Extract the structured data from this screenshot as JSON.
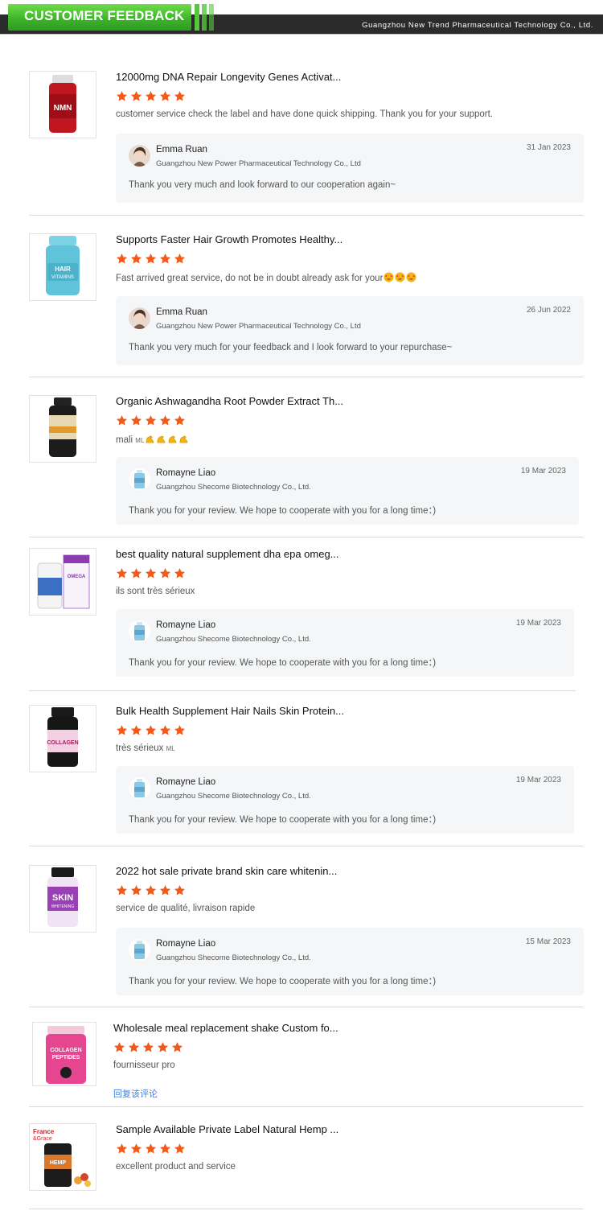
{
  "header": {
    "title": "CUSTOMER FEEDBACK",
    "company": "Guangzhou New Trend Pharmaceutical Technology Co., Ltd.",
    "accent_color": "#3cb62a",
    "bar_color": "#2b2b2b"
  },
  "star_color": "#f05a1a",
  "reviews": [
    {
      "title": "12000mg DNA Repair Longevity Genes Activat...",
      "rating": 5,
      "text": "customer service check the label and have done quick shipping. Thank you for your support.",
      "image_icon": "nmn-bottle",
      "reply": {
        "name": "Emma Ruan",
        "company": "Guangzhou New Power Pharmaceutical Technology Co., Ltd",
        "date": "31 Jan 2023",
        "text": "Thank you very much and look forward to our cooperation again~",
        "avatar": "woman-avatar"
      }
    },
    {
      "title": "Supports Faster Hair Growth Promotes Healthy...",
      "rating": 5,
      "text": "Fast arrived great service, do not be in doubt already ask for your",
      "emojis": [
        "star-struck-emoji",
        "star-struck-emoji",
        "star-struck-emoji"
      ],
      "image_icon": "hair-vitamins-jar",
      "reply": {
        "name": "Emma Ruan",
        "company": "Guangzhou New Power Pharmaceutical Technology Co., Ltd",
        "date": "26 Jun 2022",
        "text": "Thank you very much for your feedback and I look forward to your repurchase~",
        "avatar": "woman-avatar"
      }
    },
    {
      "title": "Organic Ashwagandha Root Powder Extract Th...",
      "rating": 5,
      "text": "mali",
      "suffix": "ML",
      "emojis": [
        "flexed-biceps-emoji",
        "flexed-biceps-emoji",
        "flexed-biceps-emoji",
        "flexed-biceps-emoji"
      ],
      "image_icon": "ashwagandha-bottle",
      "reply": {
        "name": "Romayne Liao",
        "company": "Guangzhou Shecome Biotechnology Co., Ltd.",
        "date": "19 Mar 2023",
        "text": "Thank you for your review. We hope to cooperate with you for a long time：)",
        "avatar": "bottle-avatar"
      }
    },
    {
      "title": "best quality natural supplement dha epa omeg...",
      "rating": 5,
      "text": "ils sont très sérieux",
      "image_icon": "omega-bottle",
      "reply": {
        "name": "Romayne Liao",
        "company": "Guangzhou Shecome Biotechnology Co., Ltd.",
        "date": "19 Mar 2023",
        "text": "Thank you for your review. We hope to cooperate with you for a long time：)",
        "avatar": "bottle-avatar"
      }
    },
    {
      "title": "Bulk Health Supplement Hair Nails Skin Protein...",
      "rating": 5,
      "text": "très sérieux",
      "suffix": "ML",
      "image_icon": "collagen-bottle",
      "reply": {
        "name": "Romayne Liao",
        "company": "Guangzhou Shecome Biotechnology Co., Ltd.",
        "date": "19 Mar 2023",
        "text": "Thank you for your review. We hope to cooperate with you for a long time：)",
        "avatar": "bottle-avatar"
      }
    },
    {
      "title": "2022 hot sale private brand skin care whitenin...",
      "rating": 5,
      "text": "service de qualité, livraison rapide",
      "image_icon": "skin-whitening-bottle",
      "reply": {
        "name": "Romayne Liao",
        "company": "Guangzhou Shecome Biotechnology Co., Ltd.",
        "date": "15 Mar 2023",
        "text": "Thank you for your review. We hope to cooperate with you for a long time：)",
        "avatar": "bottle-avatar"
      }
    },
    {
      "title": "Wholesale meal replacement shake Custom fo...",
      "rating": 5,
      "text": "fournisseur  pro",
      "image_icon": "collagen-peptides-jar",
      "reply_link": "回复该评论"
    },
    {
      "title": "Sample Available Private Label Natural Hemp ...",
      "rating": 5,
      "text": "excellent product and service",
      "image_icon": "hemp-gummies-bottle",
      "brand_mark": "France & Grace"
    }
  ]
}
